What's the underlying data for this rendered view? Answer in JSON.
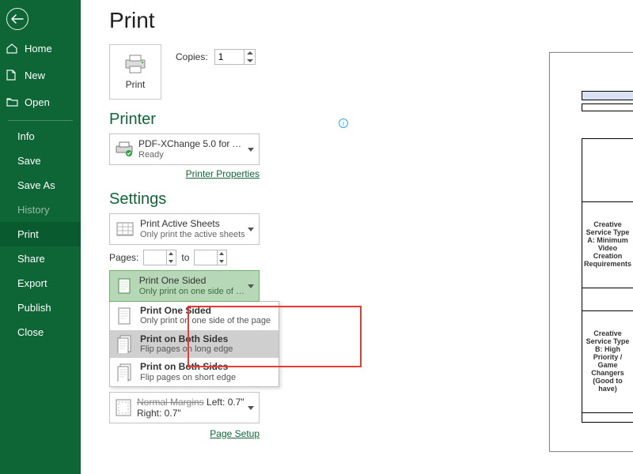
{
  "sidebar": {
    "top": [
      {
        "icon": "home-icon",
        "label": "Home"
      },
      {
        "icon": "document-icon",
        "label": "New"
      },
      {
        "icon": "folder-open-icon",
        "label": "Open"
      }
    ],
    "bottom": [
      {
        "key": "info",
        "label": "Info",
        "dim": false
      },
      {
        "key": "save",
        "label": "Save",
        "dim": false
      },
      {
        "key": "saveas",
        "label": "Save As",
        "dim": false
      },
      {
        "key": "history",
        "label": "History",
        "dim": true
      },
      {
        "key": "print",
        "label": "Print",
        "active": true
      },
      {
        "key": "share",
        "label": "Share"
      },
      {
        "key": "export",
        "label": "Export"
      },
      {
        "key": "publish",
        "label": "Publish"
      },
      {
        "key": "close",
        "label": "Close"
      }
    ]
  },
  "page": {
    "title": "Print"
  },
  "printButton": {
    "label": "Print"
  },
  "copies": {
    "label": "Copies:",
    "value": "1"
  },
  "printer": {
    "heading": "Printer",
    "name": "PDF-XChange 5.0 for ABBY…",
    "status": "Ready",
    "propsLink": "Printer Properties"
  },
  "settings": {
    "heading": "Settings",
    "printWhat": {
      "title": "Print Active Sheets",
      "sub": "Only print the active sheets"
    },
    "pages": {
      "label": "Pages:",
      "to": "to"
    },
    "sides": {
      "selected": {
        "title": "Print One Sided",
        "sub": "Only print on one side of th…"
      },
      "options": [
        {
          "title": "Print One Sided",
          "sub": "Only print on one side of the page"
        },
        {
          "title": "Print on Both Sides",
          "sub": "Flip pages on long edge"
        },
        {
          "title": "Print on Both Sides",
          "sub": "Flip pages on short edge"
        }
      ]
    },
    "margins": {
      "title": "Normal Margins",
      "sub": "Left:  0.7\"    Right:  0.7\""
    },
    "pageSetup": "Page Setup"
  },
  "preview": {
    "blockA": "Creative Service Type A: Minimum Video Creation Requirements",
    "blockB": "Creative Service Type B: High Priority / Game Changers (Good to have)"
  }
}
